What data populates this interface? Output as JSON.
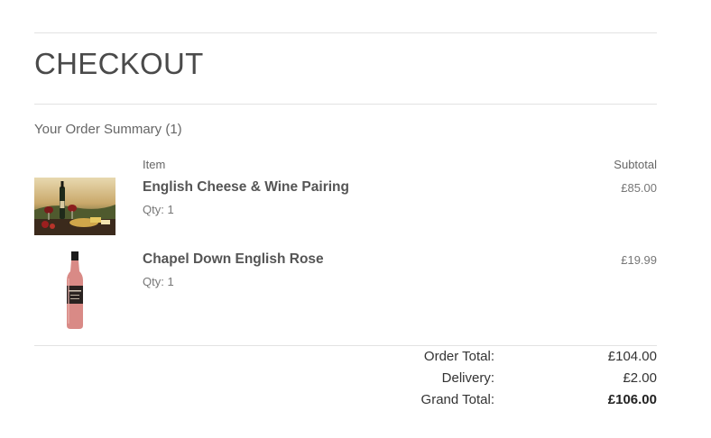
{
  "page": {
    "title": "CHECKOUT",
    "summary_heading": "Your Order Summary (1)"
  },
  "table": {
    "col_item": "Item",
    "col_subtotal": "Subtotal"
  },
  "items": [
    {
      "name": "English Cheese & Wine Pairing",
      "qty": "Qty: 1",
      "subtotal": "£85.00",
      "image": "cheese-wine-photo"
    },
    {
      "name": "Chapel Down English Rose",
      "qty": "Qty: 1",
      "subtotal": "£19.99",
      "image": "rose-bottle-photo"
    }
  ],
  "totals": {
    "order_total_label": "Order Total:",
    "order_total_value": "£104.00",
    "delivery_label": "Delivery:",
    "delivery_value": "£2.00",
    "grand_total_label": "Grand Total:",
    "grand_total_value": "£106.00"
  }
}
